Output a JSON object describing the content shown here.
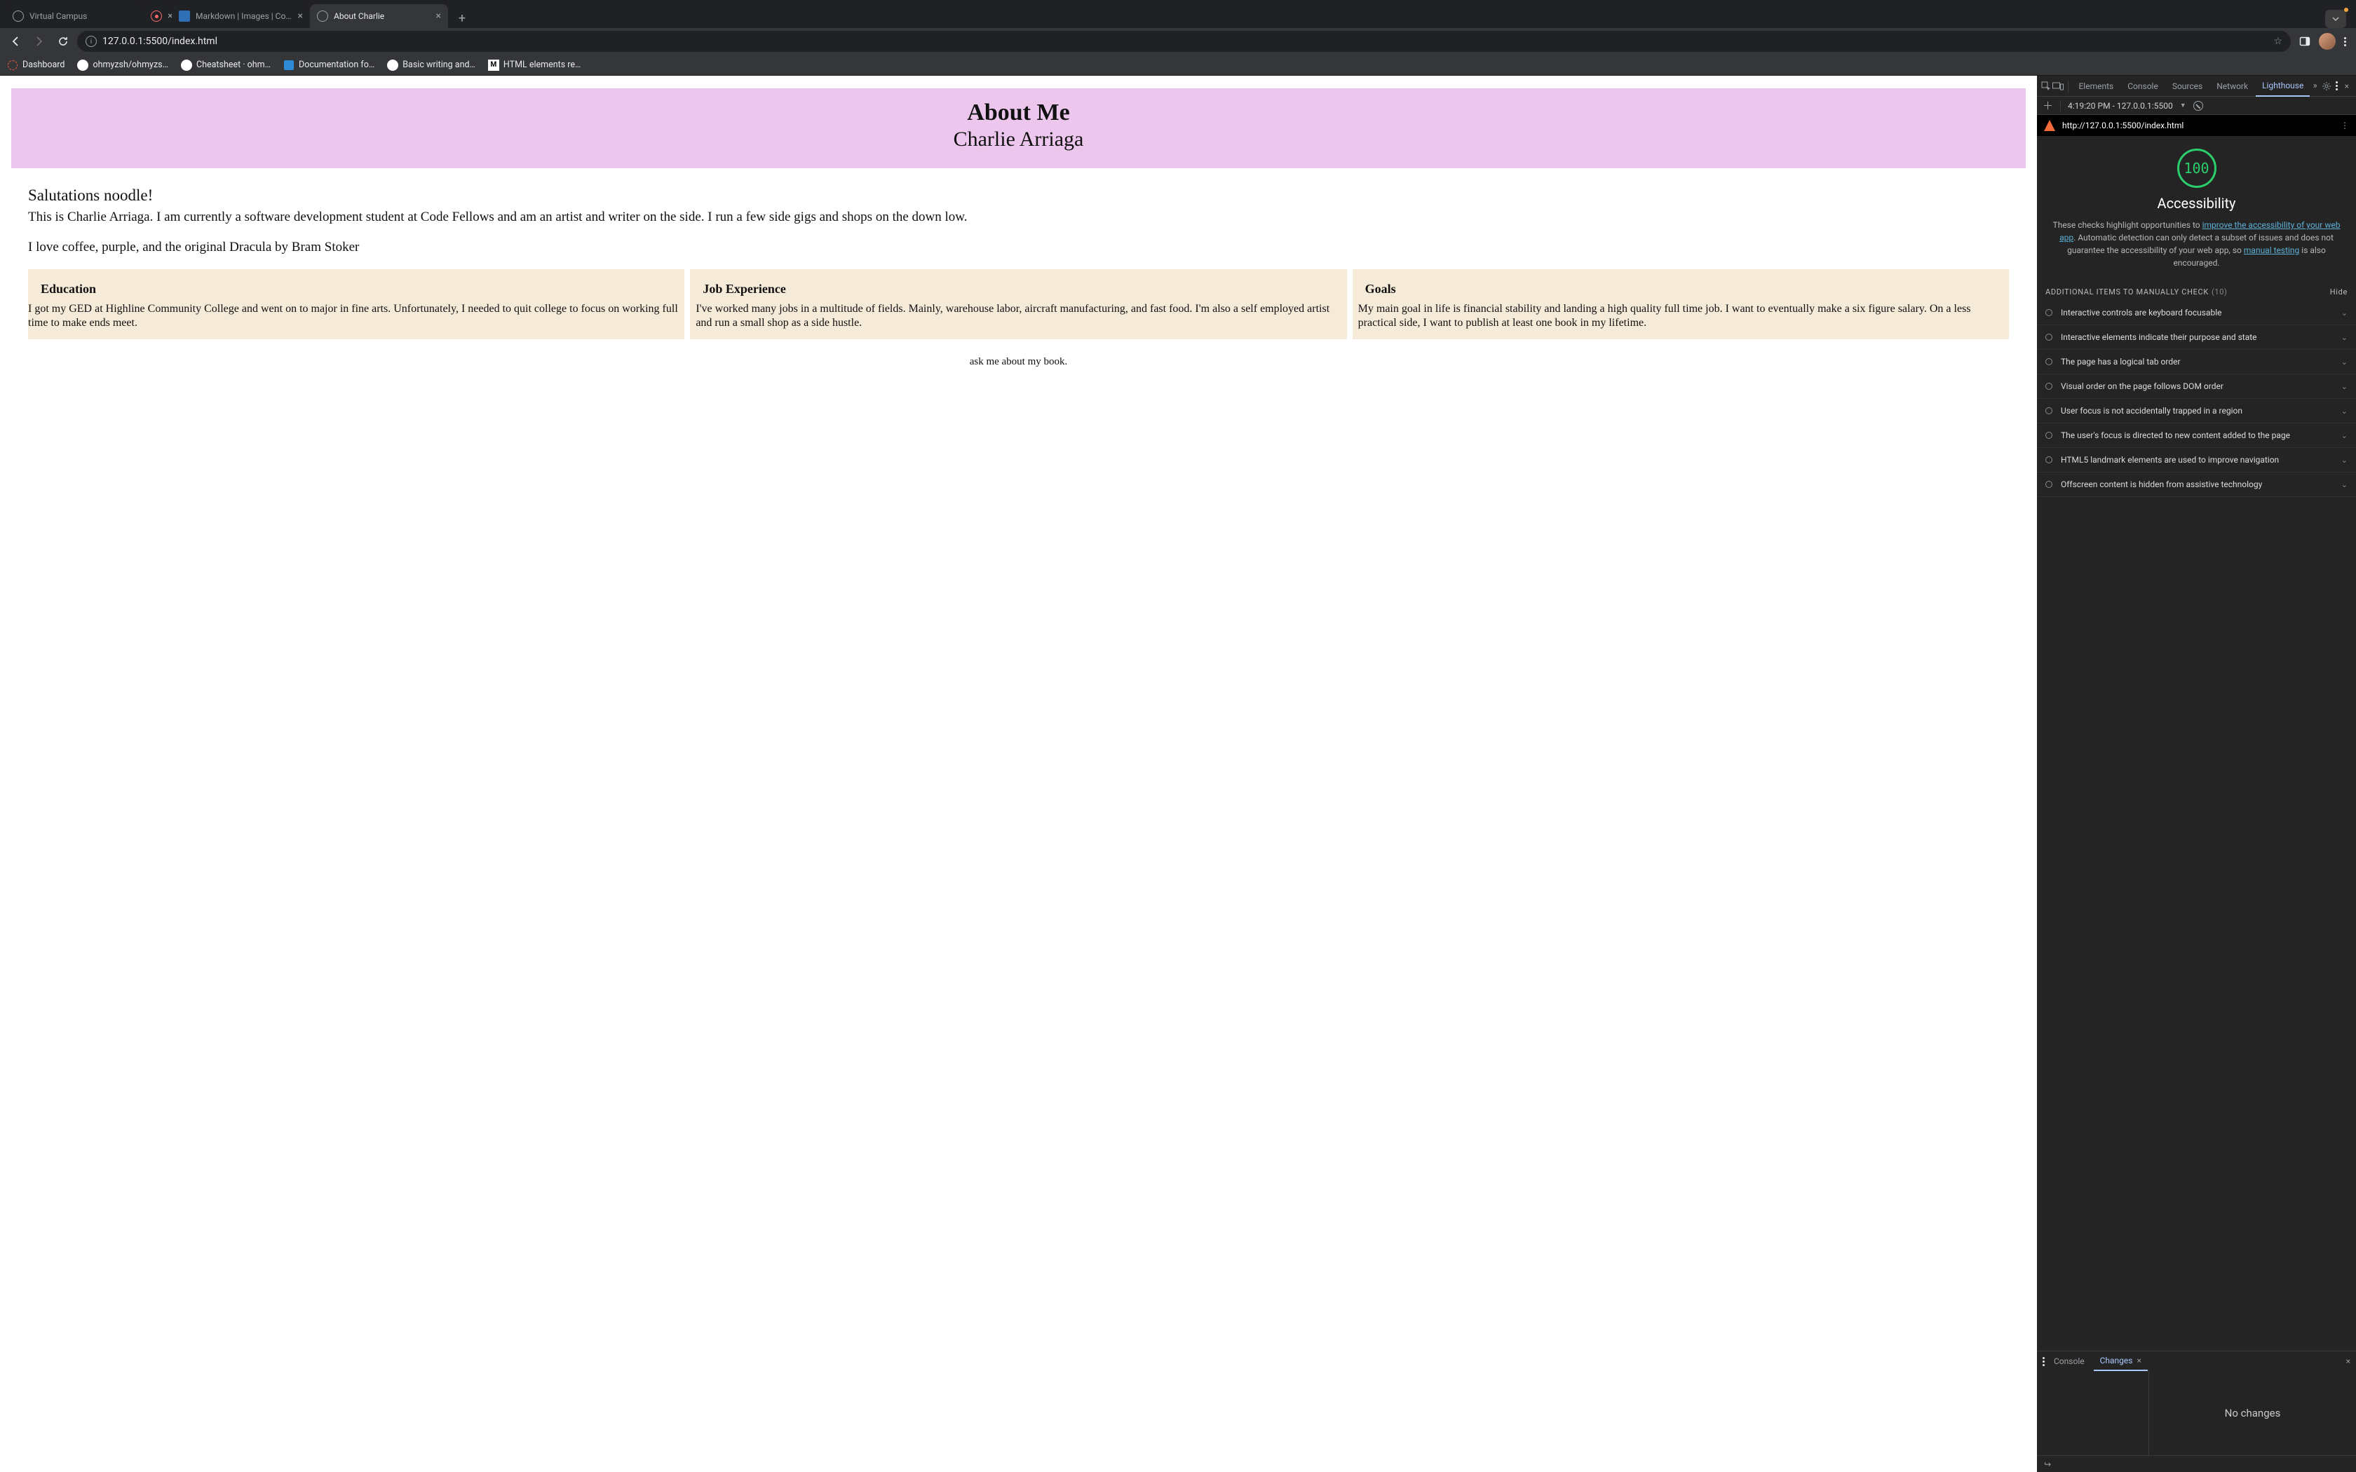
{
  "browser": {
    "tabs": [
      {
        "title": "Virtual Campus",
        "favicon": "globe",
        "active": false,
        "closeable": false
      },
      {
        "title": "",
        "favicon": "rec",
        "active": false,
        "closeable": true
      },
      {
        "title": "Markdown | Images | Codeca",
        "favicon": "doc",
        "active": false,
        "closeable": true
      },
      {
        "title": "About Charlie",
        "favicon": "globe",
        "active": true,
        "closeable": true
      }
    ],
    "url": "127.0.0.1:5500/index.html",
    "bookmarks": [
      {
        "label": "Dashboard",
        "icon": "dash"
      },
      {
        "label": "ohmyzsh/ohmyzs…",
        "icon": "gh"
      },
      {
        "label": "Cheatsheet · ohm…",
        "icon": "gh"
      },
      {
        "label": "Documentation fo…",
        "icon": "vs"
      },
      {
        "label": "Basic writing and…",
        "icon": "gh"
      },
      {
        "label": "HTML elements re…",
        "icon": "m"
      }
    ]
  },
  "page": {
    "banner_title": "About Me",
    "banner_subtitle": "Charlie Arriaga",
    "greeting": "Salutations noodle!",
    "intro": "This is Charlie Arriaga. I am currently a software development student at Code Fellows and am an artist and writer on the side. I run a few side gigs and shops on the down low.",
    "coffee": "I love coffee, purple, and the original Dracula by Bram Stoker",
    "cards": [
      {
        "title": "Education",
        "body": "I got my GED at Highline Community College and went on to major in fine arts. Unfortunately, I needed to quit college to focus on working full time to make ends meet."
      },
      {
        "title": "Job Experience",
        "body": "I've worked many jobs in a multitude of fields. Mainly, warehouse labor, aircraft manufacturing, and fast food. I'm also a self employed artist and run a small shop as a side hustle."
      },
      {
        "title": "Goals",
        "body": "My main goal in life is financial stability and landing a high quality full time job. I want to eventually make a six figure salary. On a less practical side, I want to publish at least one book in my lifetime."
      }
    ],
    "footer": "ask me about my book."
  },
  "devtools": {
    "tabs": [
      "Elements",
      "Console",
      "Sources",
      "Network",
      "Lighthouse"
    ],
    "active_tab": "Lighthouse",
    "lh_timestamp": "4:19:20 PM - 127.0.0.1:5500",
    "lh_url": "http://127.0.0.1:5500/index.html",
    "score": "100",
    "category": "Accessibility",
    "description_pre": "These checks highlight opportunities to ",
    "description_link1": "improve the accessibility of your web app",
    "description_mid": ". Automatic detection can only detect a subset of issues and does not guarantee the accessibility of your web app, so ",
    "description_link2": "manual testing",
    "description_post": " is also encouraged.",
    "manual_header": "ADDITIONAL ITEMS TO MANUALLY CHECK",
    "manual_count": "(10)",
    "hide_label": "Hide",
    "audits": [
      "Interactive controls are keyboard focusable",
      "Interactive elements indicate their purpose and state",
      "The page has a logical tab order",
      "Visual order on the page follows DOM order",
      "User focus is not accidentally trapped in a region",
      "The user's focus is directed to new content added to the page",
      "HTML5 landmark elements are used to improve navigation",
      "Offscreen content is hidden from assistive technology"
    ],
    "drawer_tabs": [
      "Console",
      "Changes"
    ],
    "drawer_active": "Changes",
    "no_changes": "No changes"
  }
}
